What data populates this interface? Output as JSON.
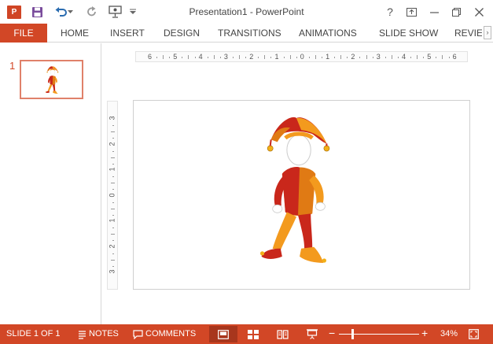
{
  "app": {
    "title": "Presentation1 - PowerPoint",
    "logo_text": "P"
  },
  "quick_access": {
    "icons": [
      "save-icon",
      "undo-icon",
      "redo-icon",
      "start-from-beginning-icon",
      "customize-qat-icon"
    ]
  },
  "window_controls": {
    "help": "?",
    "icons": [
      "ribbon-display-options-icon",
      "minimize-icon",
      "restore-icon",
      "close-icon"
    ]
  },
  "ribbon": {
    "file_tab": "FILE",
    "tabs": [
      "HOME",
      "INSERT",
      "DESIGN",
      "TRANSITIONS",
      "ANIMATIONS",
      "SLIDE SHOW",
      "REVIEW"
    ],
    "scroll_glyph": "›"
  },
  "thumbnails": {
    "slide_number": "1"
  },
  "rulers": {
    "horizontal": [
      "6",
      "5",
      "4",
      "3",
      "2",
      "1",
      "0",
      "1",
      "2",
      "3",
      "4",
      "5",
      "6"
    ],
    "vertical": [
      "3",
      "2",
      "1",
      "0",
      "1",
      "2",
      "3"
    ]
  },
  "slide": {
    "image": "jester-3d-figure"
  },
  "status_bar": {
    "slide_indicator": "SLIDE 1 OF 1",
    "notes": "NOTES",
    "comments": "COMMENTS",
    "zoom_level": "34%",
    "zoom_minus": "−",
    "zoom_plus": "+",
    "zoom_fraction": 0.34,
    "colors": {
      "accent": "#d24726",
      "active_view": "#a8361d"
    }
  }
}
